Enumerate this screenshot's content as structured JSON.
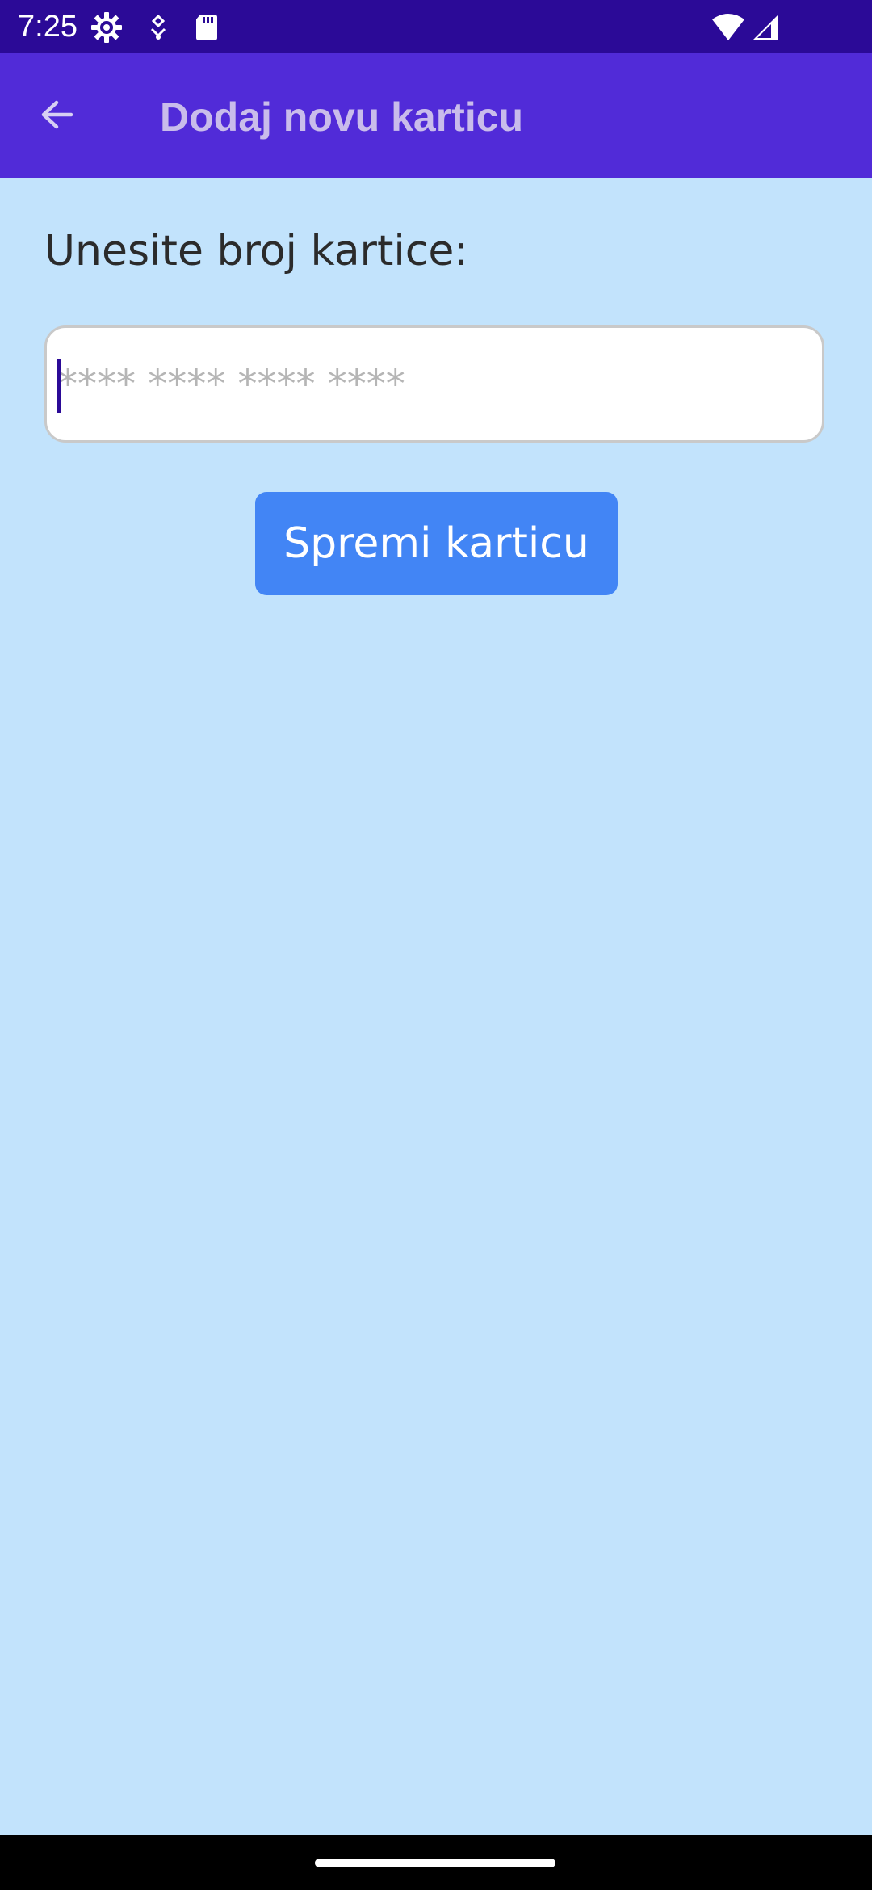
{
  "status_bar": {
    "time": "7:25",
    "icons": [
      "settings-gear-icon",
      "notification-icon",
      "sd-card-icon",
      "wifi-icon",
      "cellular-signal-icon"
    ],
    "background": "#2B0A97"
  },
  "app_bar": {
    "back_icon": "arrow-back-icon",
    "title": "Dodaj novu karticu",
    "background": "#512BD8"
  },
  "form": {
    "label": "Unesite broj kartice:",
    "card_input": {
      "value": "",
      "placeholder": "**** **** **** ****"
    },
    "save_button_label": "Spremi karticu",
    "button_color": "#4285F5"
  },
  "theme": {
    "page_background": "#C2E3FC"
  }
}
